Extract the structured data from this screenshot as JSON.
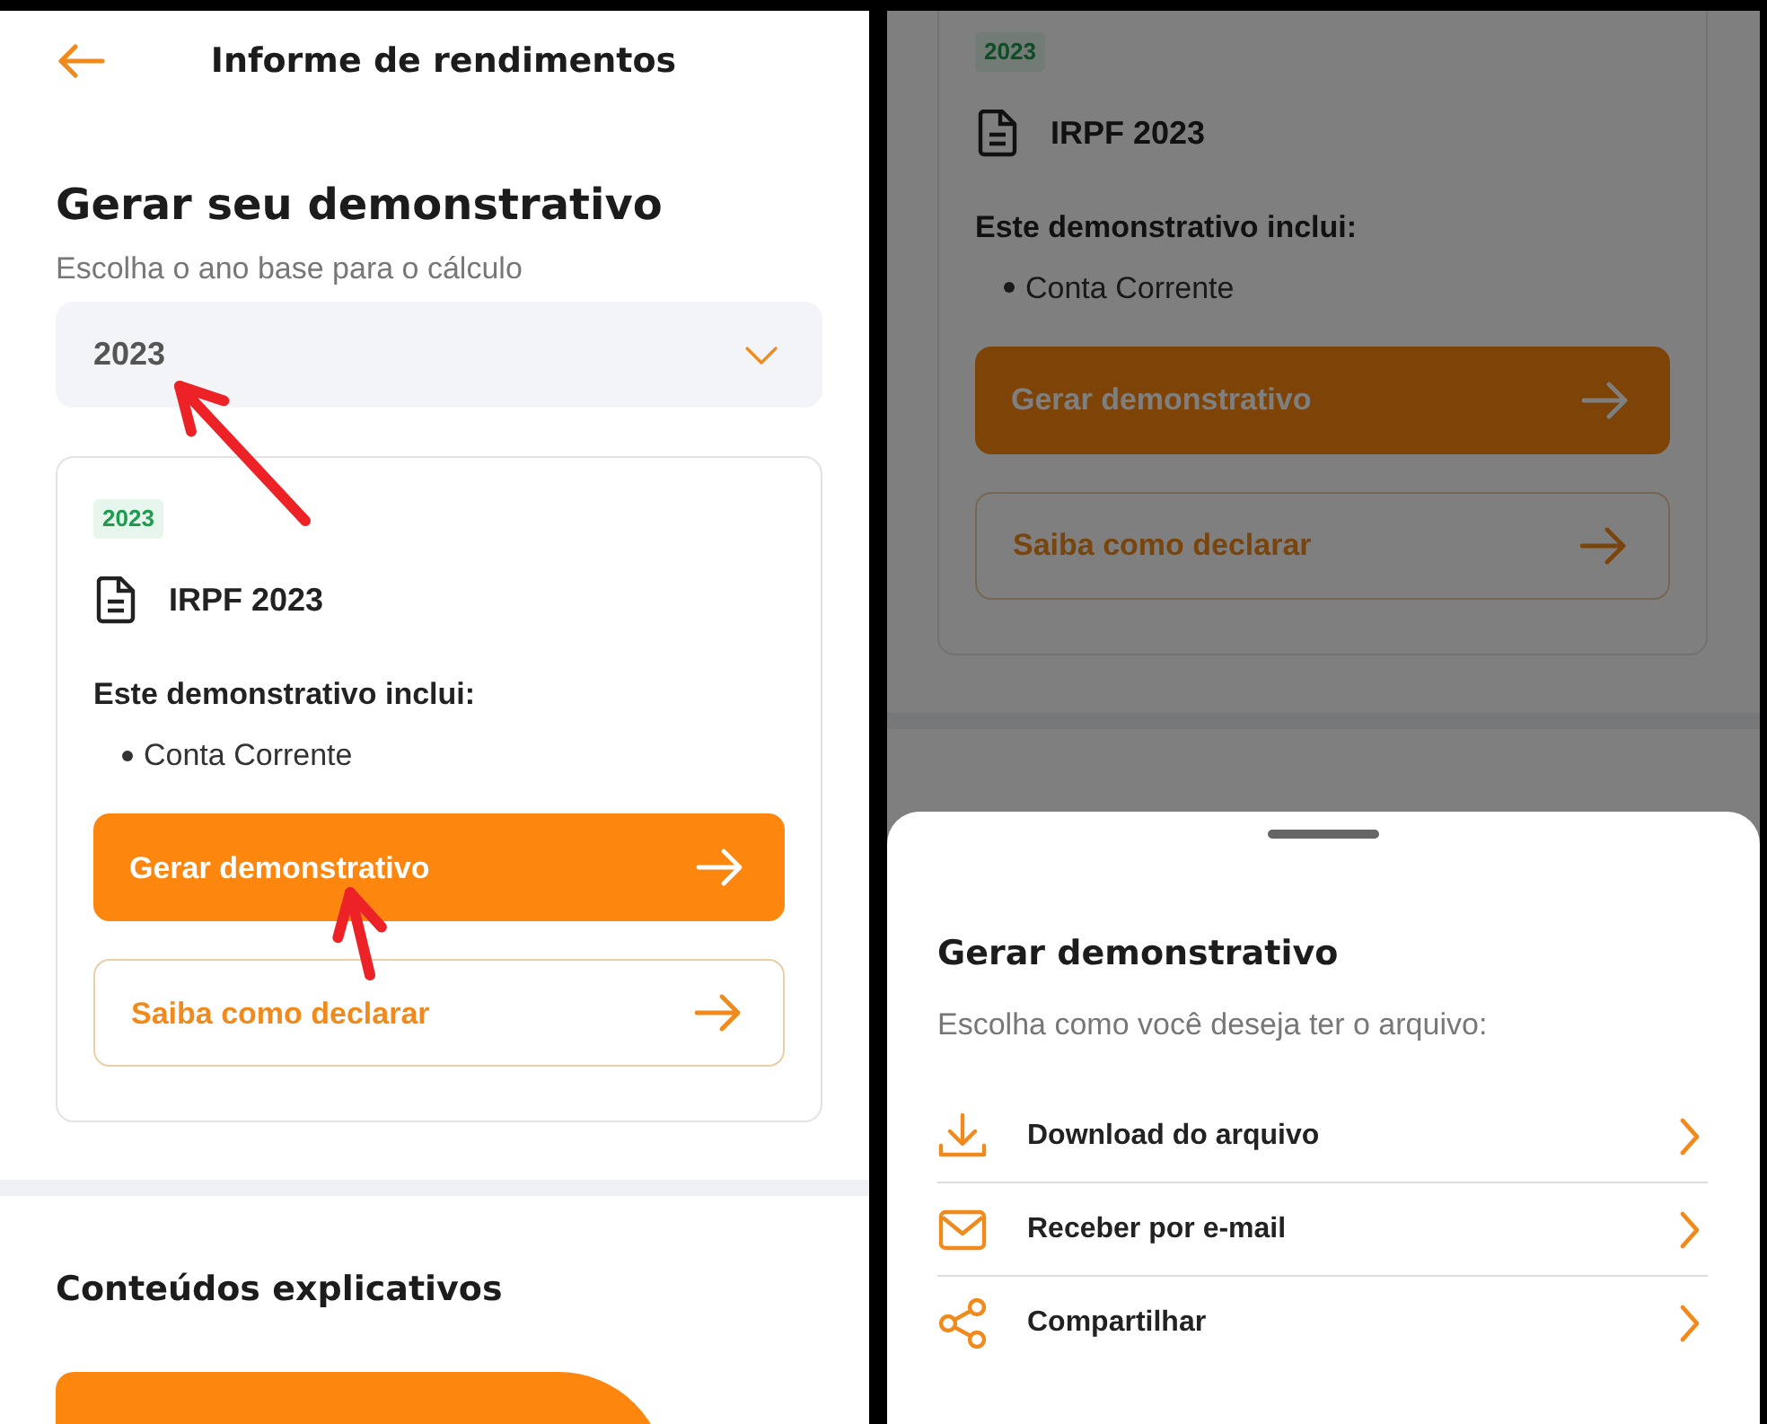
{
  "left_screen": {
    "header": {
      "title": "Informe de rendimentos"
    },
    "heading": "Gerar seu demonstrativo",
    "subtitle": "Escolha o ano base para o cálculo",
    "year_select": {
      "value": "2023"
    },
    "statement_card": {
      "badge": "2023",
      "title": "IRPF 2023",
      "includes_label": "Este demonstrativo inclui:",
      "items": [
        "Conta Corrente"
      ],
      "buttons": [
        {
          "label": "Gerar demonstrativo",
          "kind": "primary"
        },
        {
          "label": "Saiba como declarar",
          "kind": "outline"
        }
      ]
    },
    "section_title": "Conteúdos explicativos",
    "annotations": [
      {
        "kind": "arrow"
      },
      {
        "kind": "arrow"
      }
    ]
  },
  "right_screen": {
    "statement_card": {
      "badge": "2023",
      "title": "IRPF 2023",
      "includes_label": "Este demonstrativo inclui:",
      "items": [
        "Conta Corrente"
      ],
      "buttons": [
        {
          "label": "Gerar demonstrativo",
          "kind": "primary"
        },
        {
          "label": "Saiba como declarar",
          "kind": "outline"
        }
      ]
    },
    "sheet": {
      "title": "Gerar demonstrativo",
      "subtitle": "Escolha como você deseja ter o arquivo:",
      "options": [
        {
          "label": "Download do arquivo",
          "kind": "download"
        },
        {
          "label": "Receber por e-mail",
          "kind": "email"
        },
        {
          "label": "Compartilhar",
          "kind": "share"
        }
      ]
    }
  }
}
